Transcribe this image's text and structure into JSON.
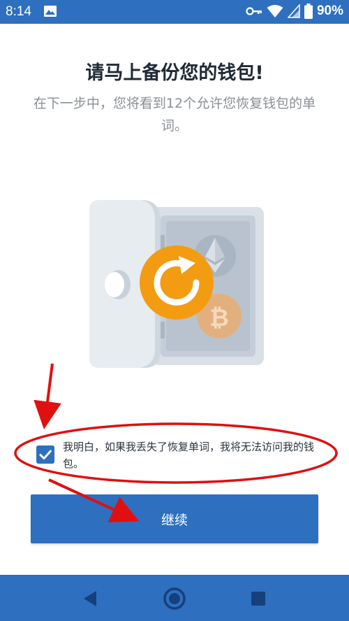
{
  "status_bar": {
    "time": "8:14",
    "battery_percent": "90%",
    "icons": [
      "image-icon",
      "key-icon",
      "wifi-icon",
      "signal-icon",
      "battery-icon"
    ]
  },
  "main": {
    "title": "请马上备份您的钱包!",
    "subtitle": "在下一步中，您将看到12个允许您恢复钱包的单词。",
    "illustration_icons": [
      "safe-icon",
      "ethereum-icon",
      "bitcoin-icon",
      "restore-icon"
    ]
  },
  "agreement": {
    "checked": true,
    "text": "我明白，如果我丢失了恢复单词，我将无法访问我的钱包。"
  },
  "continue_button": {
    "label": "继续"
  },
  "nav_bar": {
    "icons": [
      "back-icon",
      "home-icon",
      "recents-icon"
    ]
  },
  "colors": {
    "primary": "#2e6fbf",
    "accent_orange": "#f39c12",
    "annotation_red": "#e01010"
  }
}
